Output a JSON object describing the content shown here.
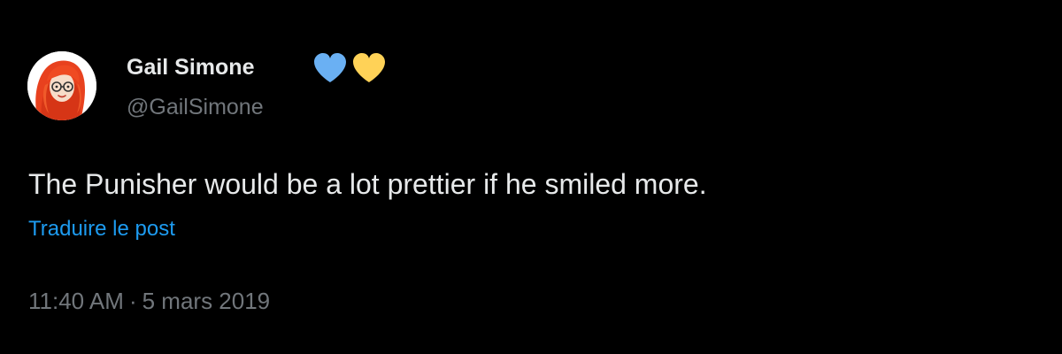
{
  "theme": {
    "background": "#000000",
    "text_primary": "#e7e9ea",
    "text_secondary": "#71767b",
    "link": "#1d9bf0",
    "badge_colors": [
      "#6ab0f3",
      "#ffd257"
    ]
  },
  "author": {
    "avatar_icon": "cartoon-woman-red-hair-glasses",
    "name": "Gail Simone",
    "badges": [
      "blue-heart-icon",
      "yellow-heart-icon"
    ],
    "handle": "@GailSimone"
  },
  "tweet": {
    "text": "The Punisher would be a lot prettier if he smiled more.",
    "translate_label": "Traduire le post",
    "time": "11:40 AM",
    "separator": "·",
    "date": "5 mars 2019"
  }
}
